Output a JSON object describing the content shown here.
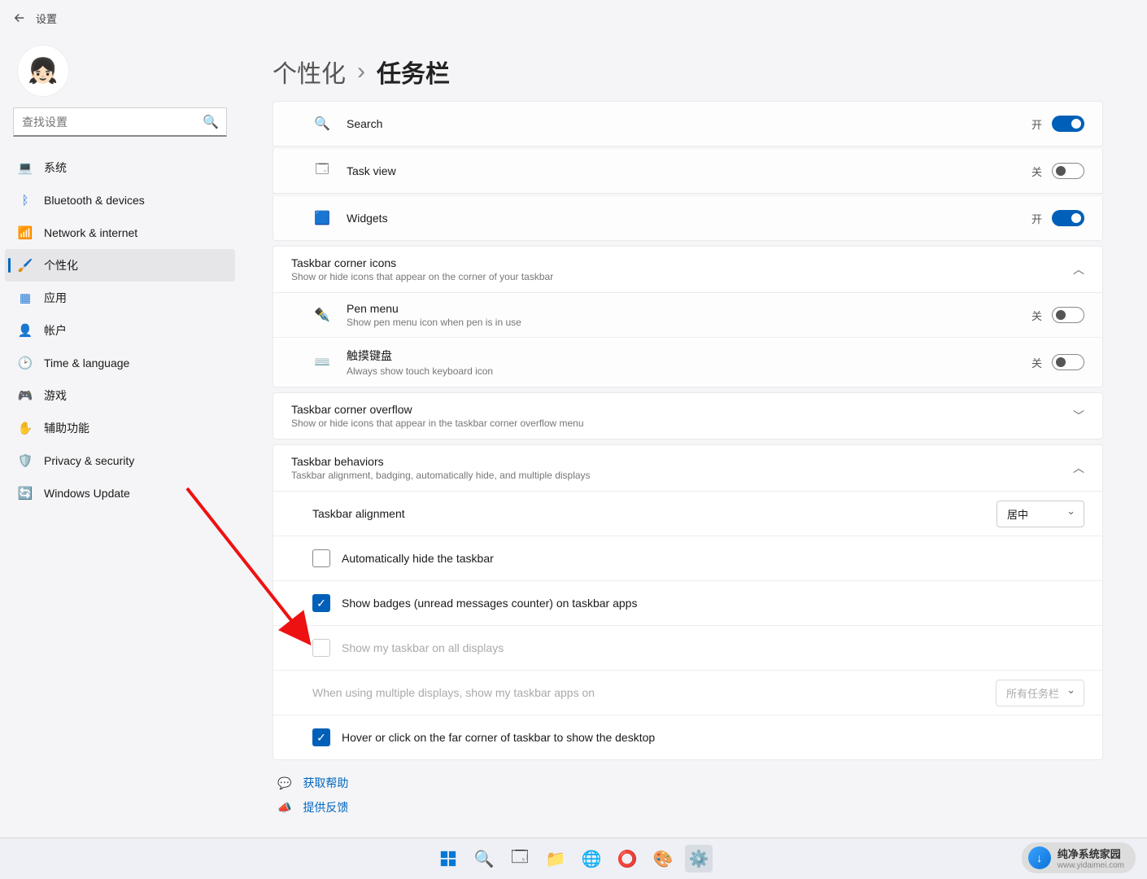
{
  "header": {
    "title": "设置"
  },
  "search": {
    "placeholder": "查找设置"
  },
  "nav": {
    "items": [
      {
        "icon": "💻",
        "color": "#2b7cd3",
        "label": "系统"
      },
      {
        "icon": "ᛒ",
        "color": "#2b7cd3",
        "label": "Bluetooth & devices"
      },
      {
        "icon": "📶",
        "color": "#2b7cd3",
        "label": "Network & internet"
      },
      {
        "icon": "🖌️",
        "color": "#d67a00",
        "label": "个性化"
      },
      {
        "icon": "▦",
        "color": "#2b7cd3",
        "label": "应用"
      },
      {
        "icon": "👤",
        "color": "#e05a5a",
        "label": "帐户"
      },
      {
        "icon": "🕑",
        "color": "#2b7cd3",
        "label": "Time & language"
      },
      {
        "icon": "🎮",
        "color": "#888",
        "label": "游戏"
      },
      {
        "icon": "✋",
        "color": "#2b7cd3",
        "label": "辅助功能"
      },
      {
        "icon": "🛡️",
        "color": "#888",
        "label": "Privacy & security"
      },
      {
        "icon": "🔄",
        "color": "#2b7cd3",
        "label": "Windows Update"
      }
    ]
  },
  "breadcrumb": {
    "parent": "个性化",
    "sep": "›",
    "current": "任务栏"
  },
  "toggle_states": {
    "on": "开",
    "off": "关"
  },
  "items": {
    "search": {
      "label": "Search",
      "state": "on"
    },
    "taskview": {
      "label": "Task view",
      "state": "off"
    },
    "widgets": {
      "label": "Widgets",
      "state": "on"
    }
  },
  "corner_icons": {
    "title": "Taskbar corner icons",
    "sub": "Show or hide icons that appear on the corner of your taskbar",
    "pen": {
      "label": "Pen menu",
      "sub": "Show pen menu icon when pen is in use",
      "state": "off"
    },
    "touch": {
      "label": "触摸键盘",
      "sub": "Always show touch keyboard icon",
      "state": "off"
    }
  },
  "overflow": {
    "title": "Taskbar corner overflow",
    "sub": "Show or hide icons that appear in the taskbar corner overflow menu"
  },
  "behaviors": {
    "title": "Taskbar behaviors",
    "sub": "Taskbar alignment, badging, automatically hide, and multiple displays",
    "alignment": {
      "label": "Taskbar alignment",
      "value": "居中"
    },
    "autohide": {
      "label": "Automatically hide the taskbar",
      "checked": false
    },
    "badges": {
      "label": "Show badges (unread messages counter) on taskbar apps",
      "checked": true
    },
    "alldisplays": {
      "label": "Show my taskbar on all displays",
      "checked": false,
      "disabled": true
    },
    "multidisplay": {
      "label": "When using multiple displays, show my taskbar apps on",
      "value": "所有任务栏",
      "disabled": true
    },
    "farcorner": {
      "label": "Hover or click on the far corner of taskbar to show the desktop",
      "checked": true
    }
  },
  "help": {
    "get": "获取帮助",
    "feedback": "提供反馈"
  },
  "watermark": {
    "big": "纯净系统家园",
    "small": "www.yidaimei.com"
  }
}
